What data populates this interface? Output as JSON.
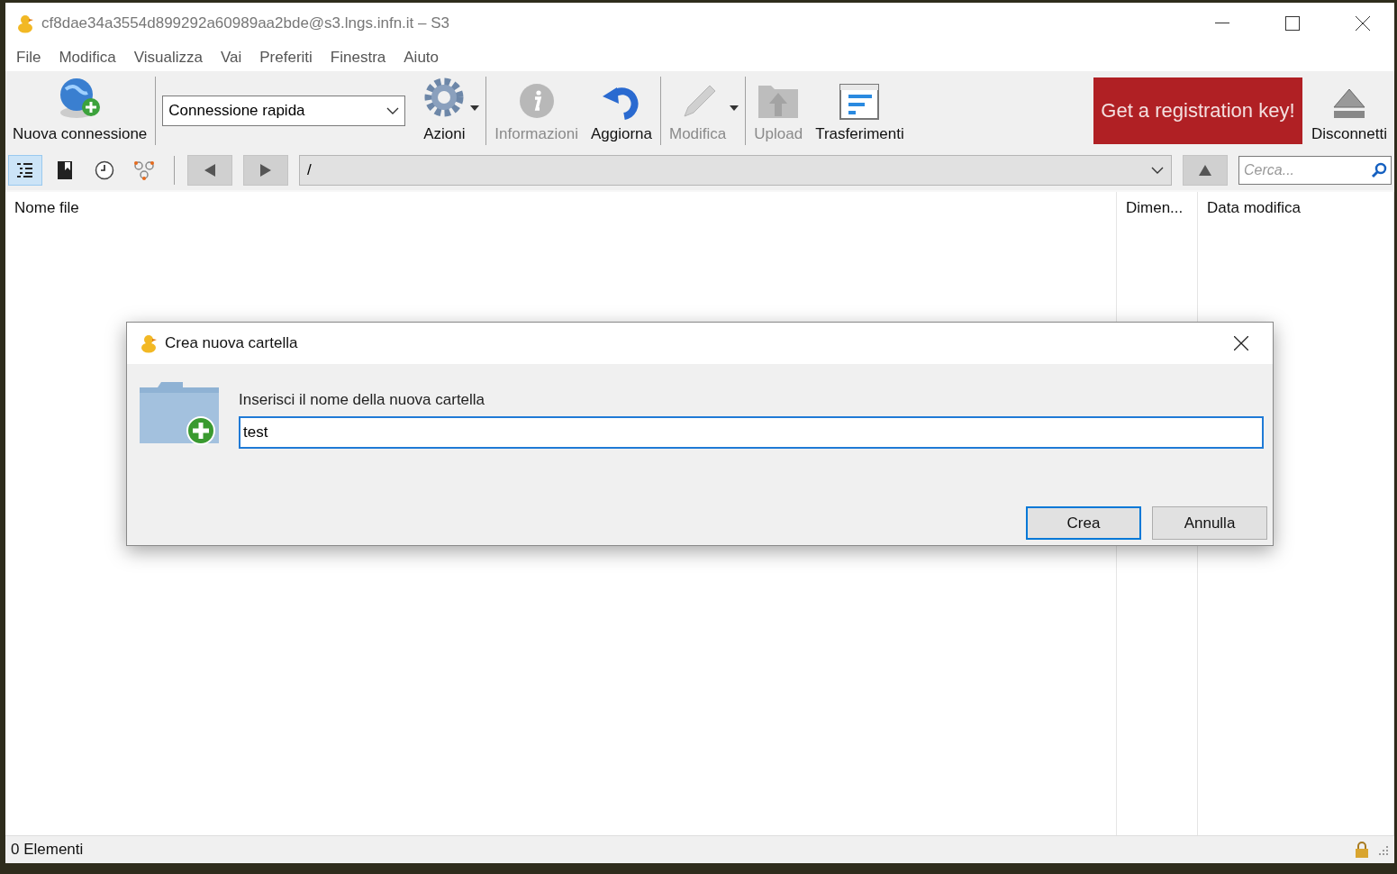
{
  "window": {
    "title": "cf8dae34a3554d899292a60989aa2bde@s3.lngs.infn.it – S3"
  },
  "menu": [
    "File",
    "Modifica",
    "Visualizza",
    "Vai",
    "Preferiti",
    "Finestra",
    "Aiuto"
  ],
  "toolbar": {
    "groups": [
      [
        {
          "kind": "tool",
          "label": "Nuova connessione",
          "disabled": false,
          "menu": false
        }
      ],
      [
        {
          "kind": "combo",
          "value": "Connessione rapida"
        },
        {
          "kind": "tool",
          "label": "Azioni",
          "disabled": false,
          "menu": true
        }
      ],
      [
        {
          "kind": "tool",
          "label": "Informazioni",
          "disabled": true,
          "menu": false
        },
        {
          "kind": "tool",
          "label": "Aggiorna",
          "disabled": false,
          "menu": false
        }
      ],
      [
        {
          "kind": "tool",
          "label": "Modifica",
          "disabled": true,
          "menu": true
        }
      ],
      [
        {
          "kind": "tool",
          "label": "Upload",
          "disabled": true,
          "menu": false
        },
        {
          "kind": "tool",
          "label": "Trasferimenti",
          "disabled": false,
          "menu": false
        }
      ],
      [
        {
          "kind": "promo",
          "label": "Get a registration key!"
        },
        {
          "kind": "tool",
          "label": "Disconnetti",
          "disabled": false,
          "menu": false
        }
      ]
    ]
  },
  "navbar": {
    "views": [
      {
        "selected": true
      },
      {
        "selected": false
      },
      {
        "selected": false
      },
      {
        "selected": false
      }
    ],
    "path": "/",
    "search": {
      "placeholder": "Cerca..."
    }
  },
  "table": {
    "columns": [
      "Nome file",
      "Dimen...",
      "Data modifica"
    ]
  },
  "dialog": {
    "title": "Crea nuova cartella",
    "prompt": "Inserisci il nome della nuova cartella",
    "value": "test",
    "buttons": [
      {
        "label": "Crea",
        "default": true
      },
      {
        "label": "Annulla",
        "default": false
      }
    ]
  },
  "status_bar": {
    "text": "0 Elementi"
  }
}
